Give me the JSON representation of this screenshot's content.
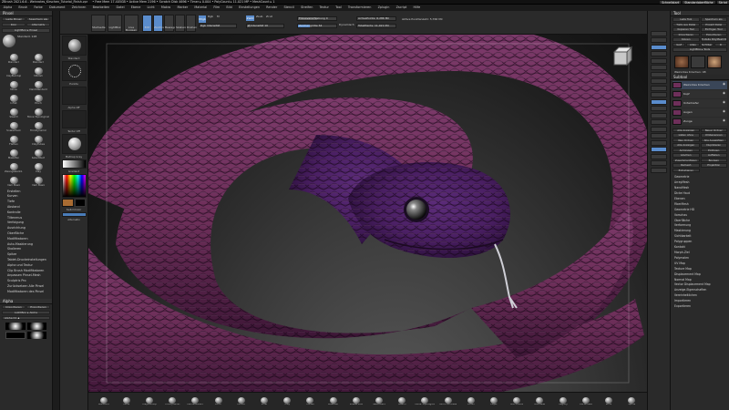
{
  "window": {
    "title": "ZBrush 2021.6.6 - Weinrotes_Kirschen_Tutorial_Finish.zpr",
    "info": "• Free Mem 17.405GB • Active Mem 2196 • Scratch Disk 4696 • Timer ▸ 0.004 • PolyCount ▸ 11.021 MP • MeshCount ▸ 1",
    "right_links": [
      "Schnellstart",
      "Standardoberfläche",
      "Skript"
    ]
  },
  "menu": [
    "Alpha",
    "Brush",
    "Farbe",
    "Dokument",
    "Zeichnen",
    "Bearbeiten",
    "Datei",
    "Ebene",
    "Licht",
    "Makro",
    "Marker",
    "Material",
    "Film",
    "Bild",
    "Einstellungen",
    "Render",
    "Stencil",
    "Streifen",
    "Textur",
    "Tool",
    "Transformieren",
    "Zplugin",
    "Zscript",
    "Hilfe"
  ],
  "left_panel": {
    "title": "Pinsel",
    "top_buttons": [
      [
        "Lade Pinsel",
        "Speichern als"
      ],
      [
        "Klon",
        "Alternativ"
      ],
      [
        "LightBox ▸ Pinsel",
        ""
      ]
    ],
    "preview_value": "Standard. 128",
    "brushes": [
      "Standard",
      "Standard",
      "ClayBuildup",
      "hPolish",
      "Move",
      "DamStandard",
      "Inflat",
      "Pinch",
      "Slash3",
      "Move Topological",
      "SnakeHook",
      "TrimDynamic",
      "Flatten",
      "ClayTubes",
      "MaskPen",
      "SelectRect",
      "Zwangswerkz.",
      "Clay",
      "Dam Basic",
      "Dam Basic"
    ],
    "subpalettes": [
      "Erstellen",
      "Kurven",
      "Tiefe",
      "Abstand",
      "Kontrolle",
      "Tiltenmus",
      "Verfolgung",
      "Ausrichtung",
      "Oberfläche",
      "Modifikatoren",
      "Auto-Maskierung",
      "Skalieren",
      "Spitze",
      "Tablet-Druckeinstellungen",
      "Alpha und Textur",
      "Clip Brush Modifikatoren",
      "Anpassen Pinsel-Mesh",
      "Sculptris Pro",
      "Zurücksetzen Alle Pinsel",
      "Modifikatoren des Pinsel"
    ],
    "alpha_title": "Alpha",
    "alpha_buttons": [
      [
        "Importieren",
        "Exportieren"
      ],
      [
        "LightBox ▸ Alpha",
        ""
      ]
    ],
    "alpha_value": "Alpha 01 ▲"
  },
  "quicktools": {
    "labels": [
      "Standard",
      "Punkte",
      "Alpha Off",
      "Textur Off",
      "MatCap Gray",
      "Gradient",
      "SwitchColor",
      "Alternativ"
    ]
  },
  "toolbar": {
    "left_buttons": [
      "Startseite",
      "LightBox",
      "Live Boolean"
    ],
    "mode_buttons": [
      "Edit",
      "Zeichnen",
      "Bewegen",
      "Skalieren",
      "Drehen"
    ],
    "rgb": {
      "label": "Mrgb",
      "rgb": "Rgb",
      "m": "M"
    },
    "zadd": "Zadd",
    "zsub": "Zsub",
    "zcut": "Zcut",
    "rgb_intensity": "Rgb Intensität",
    "z_intensity": "Z Intensität 10",
    "focal_shift": "Fokusverschiebung 0",
    "draw_size": "Zeichengröße 64",
    "dynamic": "Dynamisch",
    "active_points": "ActivePoints: 6,286 Mil",
    "total_points": "TotalPoints: 11,021 Mil",
    "brush_label": "Aktive Punktanzahl: 5,766 Mil"
  },
  "right_panel": {
    "title": "Tool",
    "top_buttons": [
      [
        "Lade Tool",
        "Speichern als"
      ],
      [
        "Tiefe aus Datei",
        "Projekt Datei"
      ],
      [
        "Kopieren Tool",
        "Einfügen Tool"
      ],
      [
        "Importieren",
        "Exportieren"
      ],
      [
        "Klonen",
        "Erstelle PolyMesh3D"
      ],
      [
        "GoZ",
        "Alles",
        "Sichtbar",
        "R"
      ],
      [
        "LightBox ▸ Tools",
        ""
      ]
    ],
    "tool_name": "Weinrotes Kirschen: 48",
    "subtools_label": "Subtool",
    "subtools": [
      "Weinrotes Kirschen",
      "Kopf",
      "Unterkiefer",
      "Augen",
      "Zunge"
    ],
    "sublist": [
      "Alle Anzeigen",
      "Neuer Ordner",
      "Listen ohne",
      "Umbenennen",
      "Neu Ordnen",
      "Alle Auswählen",
      "Alle Anzeigen",
      "Duplizieren",
      "Anhängen",
      "Einfügen",
      "Löschen",
      "Aufteilen",
      "Zusammenfügen",
      "Boolean",
      "Remesh",
      "Projektion",
      "Extrahieren"
    ],
    "lower_list": [
      "Geometrie",
      "ArrayMesh",
      "NanoMesh",
      "Dicke Haut",
      "Ebenen",
      "FiberMesh",
      "Geometrie HD",
      "Vorschau",
      "Oberfläche",
      "Verformung",
      "Maskierung",
      "Sichtbarkeit",
      "Polygruppen",
      "Kontakt",
      "Morph-Ziel",
      "Polymalen",
      "UV Map",
      "Texture Map",
      "Displacement Map",
      "Normal Map",
      "Vector Displacement Map",
      "Anzeige-Eigenschaften",
      "Vereinheitlichen",
      "Importieren",
      "Exportieren"
    ]
  },
  "bottom_brushes": [
    "Standard",
    "Move",
    "ClayBuildup",
    "TrimDynamic",
    "DamStandard",
    "Pinch",
    "hPolish",
    "Inflat",
    "Clay",
    "Flatten",
    "MaskPen",
    "SnakeHook",
    "SelectRect",
    "Slash3",
    "Move Topological",
    "IMM Primitives",
    "Polish",
    "Layer",
    "Orb Cracks",
    "ZModeler",
    "Magnify",
    "CurveTube",
    "Knife",
    "Spline"
  ],
  "colors": {
    "snake_base": "#6e2f5a",
    "snake_dark": "#3d1636",
    "snake_light": "#a85b93",
    "accent_blue": "#5a8ccc",
    "ui_bg": "#2a2a2a"
  }
}
